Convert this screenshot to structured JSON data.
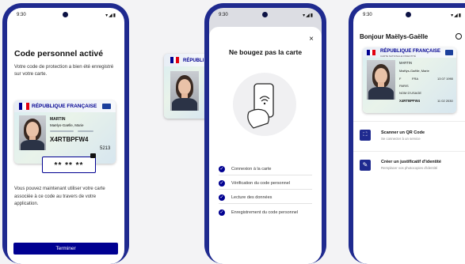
{
  "colors": {
    "brand": "#000091",
    "frame": "#1f2a8f",
    "check": "#000091"
  },
  "screen1": {
    "time": "9:30",
    "title": "Code personnel activé",
    "desc": "Votre code de protection a bien été enregistré sur votre carte.",
    "card": {
      "country": "RÉPUBLIQUE FRANÇAISE",
      "surname": "MARTIN",
      "given": "Maëlys-Gaëlle, Marie",
      "number": "X4RTBPFW4",
      "suffix": "5213"
    },
    "code": "** ** **",
    "info": "Vous pouvez maintenant utiliser votre carte associée à ce code au travers de votre application.",
    "button": "Terminer"
  },
  "floating_card": {
    "country": "RÉPUBLI"
  },
  "screen2": {
    "time": "9:30",
    "title": "Ne bougez pas la carte",
    "close": "×",
    "steps": [
      {
        "label": "Connexion à la carte"
      },
      {
        "label": "Vérification du code personnel"
      },
      {
        "label": "Lecture des données"
      },
      {
        "label": "Enregistrement du code personnel"
      }
    ]
  },
  "screen3": {
    "time": "9:30",
    "title": "Bonjour Maëlys-Gaëlle",
    "card": {
      "country": "RÉPUBLIQUE FRANÇAISE",
      "subtitle": "CARTE NATIONALE D'IDENTITÉ",
      "surname": "MARTIN",
      "given": "Maëlys-Gaëlle, Marie",
      "sex": "F",
      "nat": "FRA",
      "dob": "13 07 1990",
      "place": "PARIS",
      "alt": "NOM D'USAGE",
      "number": "X4RTBPFW4",
      "expiry": "11 02 2030"
    },
    "actions": [
      {
        "title": "Scanner un QR Code",
        "sub": "Se connecter à un service"
      },
      {
        "title": "Créer un justificatif d'identité",
        "sub": "Remplacer vos photocopies d'identité"
      }
    ]
  }
}
